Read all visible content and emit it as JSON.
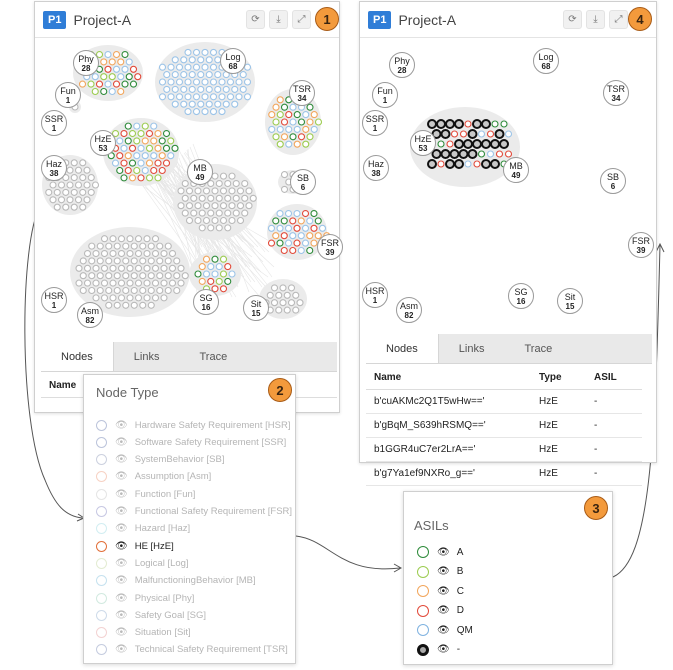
{
  "project": {
    "badge": "P1",
    "title": "Project-A"
  },
  "steps": [
    "1",
    "2",
    "3",
    "4"
  ],
  "header_icons": [
    "refresh-icon",
    "download-icon",
    "expand-icon"
  ],
  "graph_nodes": [
    {
      "name": "Phy",
      "count": "28"
    },
    {
      "name": "Log",
      "count": "68"
    },
    {
      "name": "Fun",
      "count": "1"
    },
    {
      "name": "SSR",
      "count": "1"
    },
    {
      "name": "TSR",
      "count": "34"
    },
    {
      "name": "HzE",
      "count": "53"
    },
    {
      "name": "Haz",
      "count": "38"
    },
    {
      "name": "MB",
      "count": "49"
    },
    {
      "name": "SB",
      "count": "6"
    },
    {
      "name": "FSR",
      "count": "39"
    },
    {
      "name": "HSR",
      "count": "1"
    },
    {
      "name": "Asm",
      "count": "82"
    },
    {
      "name": "SG",
      "count": "16"
    },
    {
      "name": "Sit",
      "count": "15"
    }
  ],
  "tabs": [
    "Nodes",
    "Links",
    "Trace"
  ],
  "table_left": {
    "headers": [
      "Name"
    ]
  },
  "table": {
    "headers": [
      "Name",
      "Type",
      "ASIL"
    ],
    "rows": [
      [
        "b'cuAKMc2Q1T5wHw=='",
        "HzE",
        "-"
      ],
      [
        "b'gBqM_S639hRSMQ=='",
        "HzE",
        "-"
      ],
      [
        "b1GGR4uC7er2LrA=='",
        "HzE",
        "-"
      ],
      [
        "b'g7Ya1ef9NXRo_g=='",
        "HzE",
        "-"
      ]
    ]
  },
  "node_type": {
    "title": "Node Type",
    "items": [
      {
        "label": "Hardware Safety Requirement [HSR]",
        "color": "#7a8ab8",
        "active": false
      },
      {
        "label": "Software Safety Requirement [SSR]",
        "color": "#7a8ab8",
        "active": false
      },
      {
        "label": "SystemBehavior [SB]",
        "color": "#9aa3bf",
        "active": false
      },
      {
        "label": "Assumption [Asm]",
        "color": "#f0a58a",
        "active": false
      },
      {
        "label": "Function [Fun]",
        "color": "#cccccc",
        "active": false
      },
      {
        "label": "Functional Safety Requirement [FSR]",
        "color": "#8f92c8",
        "active": false
      },
      {
        "label": "Hazard [Haz]",
        "color": "#a6dde6",
        "active": false
      },
      {
        "label": "HE [HzE]",
        "color": "#e2703a",
        "active": true
      },
      {
        "label": "Logical [Log]",
        "color": "#c7d9a6",
        "active": false
      },
      {
        "label": "MalfunctioningBehavior [MB]",
        "color": "#8ec6df",
        "active": false
      },
      {
        "label": "Physical [Phy]",
        "color": "#a6d6c2",
        "active": false
      },
      {
        "label": "Safety Goal [SG]",
        "color": "#9db7d6",
        "active": false
      },
      {
        "label": "Situation [Sit]",
        "color": "#e8a6a6",
        "active": false
      },
      {
        "label": "Technical Safety Requirement [TSR]",
        "color": "#8c9ac0",
        "active": false
      }
    ]
  },
  "asils": {
    "title": "ASILs",
    "items": [
      {
        "label": "A",
        "color": "#2e8b3a"
      },
      {
        "label": "B",
        "color": "#9ccc50"
      },
      {
        "label": "C",
        "color": "#f2a65c"
      },
      {
        "label": "D",
        "color": "#e24a3a"
      },
      {
        "label": "QM",
        "color": "#7fb2e0"
      },
      {
        "label": "-",
        "color": "#111111"
      }
    ]
  }
}
